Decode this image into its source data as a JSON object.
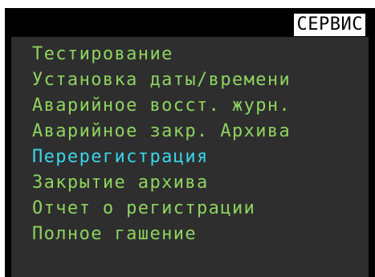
{
  "screen": {
    "title": "СЕРВИС",
    "colors": {
      "background": "#2e2e2e",
      "frame": "#000000",
      "item_text": "#8ed35f",
      "selected_text": "#39d6e8",
      "title_bg": "#ffffff",
      "title_text": "#000000"
    }
  },
  "menu": {
    "selected_index": 4,
    "items": [
      {
        "label": "Тестирование"
      },
      {
        "label": "Установка даты/времени"
      },
      {
        "label": "Аварийное восст. журн."
      },
      {
        "label": "Аварийное закр. Архива"
      },
      {
        "label": "Перерегистрация"
      },
      {
        "label": "Закрытие архива"
      },
      {
        "label": "Отчет о регистрации"
      },
      {
        "label": "Полное гашение"
      }
    ]
  }
}
